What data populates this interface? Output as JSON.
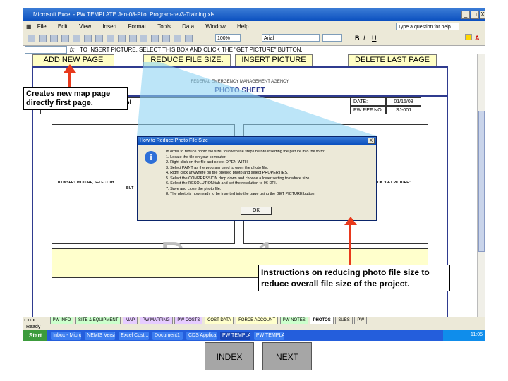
{
  "window": {
    "title": "Microsoft Excel - PW TEMPLATE Jan-08-Pilot Program-rev3-Training.xls",
    "controls": [
      "_",
      "□",
      "X"
    ]
  },
  "menu": {
    "items": [
      "File",
      "Edit",
      "View",
      "Insert",
      "Format",
      "Tools",
      "Data",
      "Window",
      "Help"
    ],
    "help_box": "Type a question for help"
  },
  "toolbar": {
    "zoom": "100%",
    "font": "Arial"
  },
  "formula_bar": {
    "cell": "",
    "content": "TO INSERT PICTURE, SELECT THIS BOX AND CLICK THE \"GET PICTURE\" BUTTON."
  },
  "sheet_buttons": {
    "add": "ADD NEW PAGE",
    "reduce": "REDUCE FILE SIZE.",
    "insert": "INSERT PICTURE",
    "delete": "DELETE LAST PAGE"
  },
  "sheet": {
    "agency": "FEDERAL EMERGENCY MANAGEMENT AGENCY",
    "heading": "PHOTO SHEET",
    "left_header_fragment": "ol",
    "date_label": "DATE:",
    "date_value": "01/15/08",
    "pw_ref_label": "PW REF NO:",
    "pw_ref_value": "SJ-001",
    "insert_note": "TO INSERT PICTURE, SELECT TH",
    "insert_note_2": "BUT",
    "get_picture_note": "CK \"GET PICTURE\"",
    "page_watermark": "Page 1"
  },
  "dialog": {
    "title": "How to Reduce Photo File Size",
    "close": "X",
    "lines": [
      "In order to reduce photo file size, follow these steps before inserting the picture into the form:",
      "1.  Locate the file on your computer.",
      "2.  Right click on the file and select OPEN WITH.",
      "3.  Select PAINT as the program used to open the photo file.",
      "4.  Right click anywhere on the opened photo and select PROPERTIES.",
      "5.  Select the COMPRESSION drop down and choose a lower setting to reduce size.",
      "6.  Select the RESOLUTION tab and set the resolution to 96 DPI.",
      "7.  Save and close the photo file.",
      "8.  The photo is now ready to be inserted into the page using the GET PICTURE button."
    ],
    "ok": "OK"
  },
  "tabs": [
    "PW INFO",
    "SITE & EQUIPMENT",
    "MAP",
    "PW MAPPING",
    "PW COSTS",
    "COST DATA",
    "FORCE ACCOUNT",
    "PW NOTES",
    "PHOTOS",
    "SUBS",
    "PW"
  ],
  "active_tab": "PHOTOS",
  "status": "Ready",
  "taskbar": {
    "start": "Start",
    "items": [
      "Inbox - Micros...",
      "NEMIS Version...",
      "Excel Cost...",
      "Document1",
      "CDS Applica...",
      "PW TEMPLA...",
      "PW TEMPLATE..."
    ],
    "time": "11:05"
  },
  "callouts": {
    "left": "Creates new map page directly first page.",
    "right": "Instructions on reducing photo file size to reduce overall file size of the project."
  },
  "nav": {
    "index": "INDEX",
    "next": "NEXT"
  }
}
